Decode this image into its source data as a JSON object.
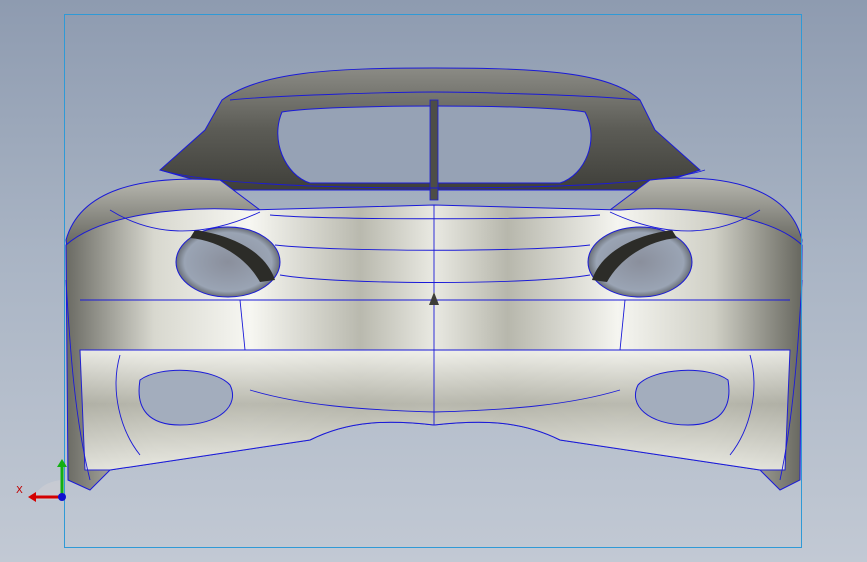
{
  "viewport": {
    "background_top": "#8e9bb0",
    "background_bottom": "#c2c9d4",
    "frame_color": "#2f9ad6"
  },
  "model": {
    "surface_color_light": "#f4f4ef",
    "surface_color_dark": "#4d4d47",
    "edge_color": "#1a1ad8"
  },
  "triad": {
    "x_label": "X",
    "x_color": "#d40000",
    "y_color": "#12b012",
    "z_color": "#1010d0"
  }
}
